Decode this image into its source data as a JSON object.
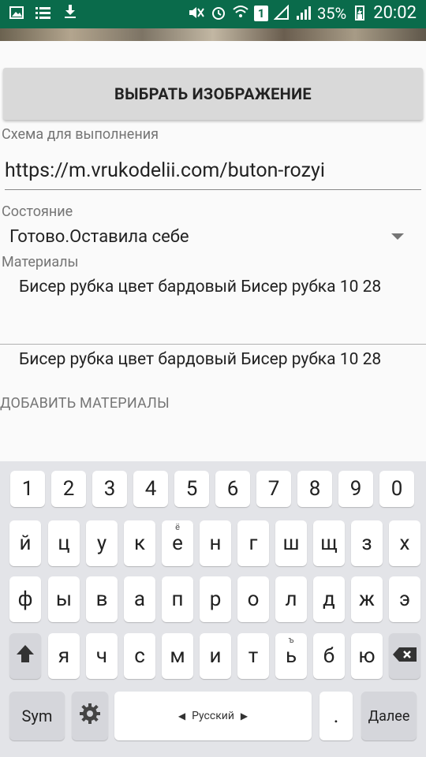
{
  "status_bar": {
    "left_icons": [
      "image-icon",
      "list-icon",
      "download-icon"
    ],
    "battery": "35%",
    "time": "20:02",
    "sim_badge": "1"
  },
  "content": {
    "select_button_label": "ВЫБРАТЬ ИЗОБРАЖЕНИЕ",
    "scheme_label": "Схема для выполнения",
    "scheme_url": "https://m.vrukodelii.com/buton-rozyi",
    "state_label": "Состояние",
    "state_value": "Готово.Оставила себе",
    "materials_label": "Материалы",
    "materials": [
      "Бисер рубка цвет бардовый Бисер рубка 10 28",
      "Бисер рубка цвет бардовый Бисер рубка 10 28"
    ],
    "add_materials_label": "ДОБАВИТЬ МАТЕРИАЛЫ"
  },
  "keyboard": {
    "row_numbers": [
      "1",
      "2",
      "3",
      "4",
      "5",
      "6",
      "7",
      "8",
      "9",
      "0"
    ],
    "row1": [
      "й",
      "ц",
      "у",
      "к",
      "е",
      "н",
      "г",
      "ш",
      "щ",
      "з",
      "х"
    ],
    "row1_alt": {
      "е": "ё"
    },
    "row2": [
      "ф",
      "ы",
      "в",
      "а",
      "п",
      "р",
      "о",
      "л",
      "д",
      "ж",
      "э"
    ],
    "row3": [
      "я",
      "ч",
      "с",
      "м",
      "и",
      "т",
      "ь",
      "б",
      "ю"
    ],
    "row3_alt": {
      "ь": "ъ"
    },
    "sym_label": "Sym",
    "space_label": "Русский",
    "period_label": ".",
    "done_label": "Далее"
  }
}
